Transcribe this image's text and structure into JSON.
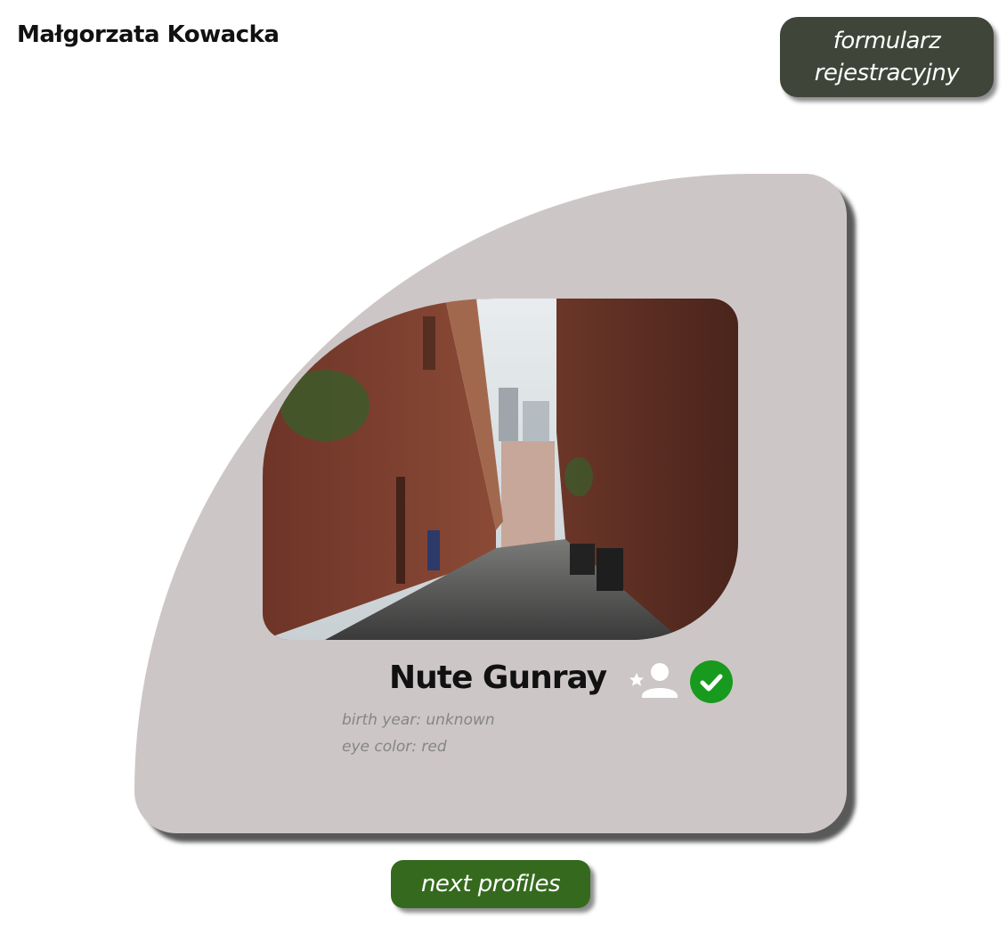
{
  "header": {
    "author_name": "Małgorzata Kowacka",
    "form_button_label": "formularz rejestracyjny"
  },
  "profile": {
    "name": "Nute Gunray",
    "birth_year": "birth year: unknown",
    "eye_color": "eye color: red",
    "photo_icon": "alley-photo",
    "actions": {
      "add_icon": "add-user-star-icon",
      "confirm_icon": "check-circle-icon"
    }
  },
  "footer": {
    "next_button_label": "next profiles"
  },
  "colors": {
    "card_bg": "#cdc6c7",
    "form_button_bg": "#3f4538",
    "next_button_bg": "#356a1e",
    "check_bg": "#179a1e",
    "meta_text": "#858585"
  }
}
